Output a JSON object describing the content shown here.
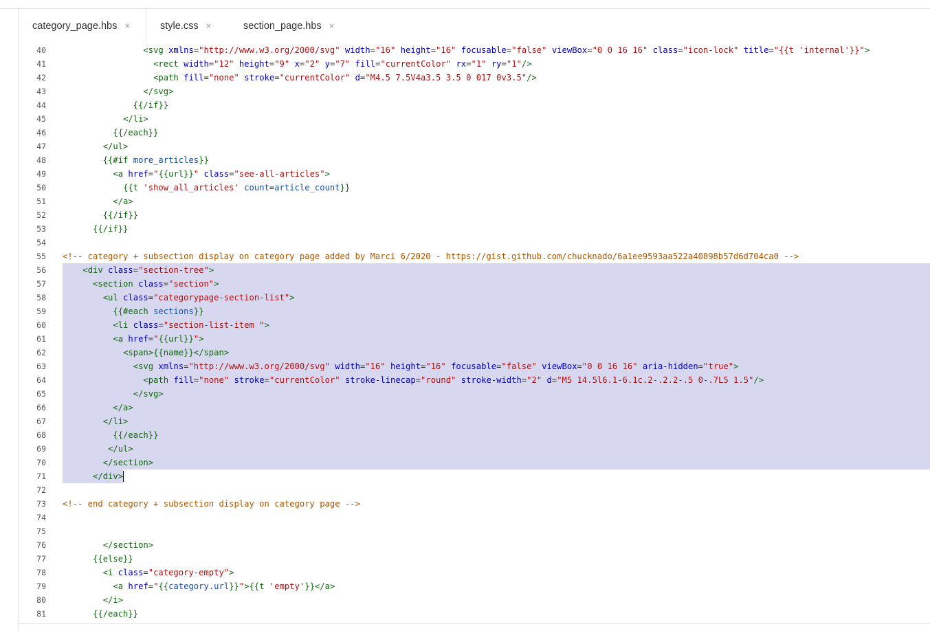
{
  "tabs": [
    {
      "label": "category_page.hbs",
      "active": true
    },
    {
      "label": "style.css",
      "active": false
    },
    {
      "label": "section_page.hbs",
      "active": false
    }
  ],
  "tab_close_glyph": "×",
  "colors": {
    "selection": "#d8d7f0",
    "tag": "#116611",
    "attribute": "#0000bb",
    "string": "#aa1111",
    "comment": "#aa5500",
    "variable": "#1a4c9e"
  },
  "lines": [
    {
      "n": "40",
      "indent": "                ",
      "tokens": [
        [
          "t",
          "<svg "
        ],
        [
          "a",
          "xmlns"
        ],
        [
          "p",
          "="
        ],
        [
          "s",
          "\"http://www.w3.org/2000/svg\""
        ],
        [
          "p",
          " "
        ],
        [
          "a",
          "width"
        ],
        [
          "p",
          "="
        ],
        [
          "s",
          "\"16\""
        ],
        [
          "p",
          " "
        ],
        [
          "a",
          "height"
        ],
        [
          "p",
          "="
        ],
        [
          "s",
          "\"16\""
        ],
        [
          "p",
          " "
        ],
        [
          "a",
          "focusable"
        ],
        [
          "p",
          "="
        ],
        [
          "s",
          "\"false\""
        ],
        [
          "p",
          " "
        ],
        [
          "a",
          "viewBox"
        ],
        [
          "p",
          "="
        ],
        [
          "s",
          "\"0 0 16 16\""
        ],
        [
          "p",
          " "
        ],
        [
          "a",
          "class"
        ],
        [
          "p",
          "="
        ],
        [
          "s",
          "\"icon-lock\""
        ],
        [
          "p",
          " "
        ],
        [
          "a",
          "title"
        ],
        [
          "p",
          "="
        ],
        [
          "s",
          "\"{{t 'internal'}}\""
        ],
        [
          "t",
          ">"
        ]
      ]
    },
    {
      "n": "41",
      "indent": "                  ",
      "tokens": [
        [
          "t",
          "<rect "
        ],
        [
          "a",
          "width"
        ],
        [
          "p",
          "="
        ],
        [
          "s",
          "\"12\""
        ],
        [
          "p",
          " "
        ],
        [
          "a",
          "height"
        ],
        [
          "p",
          "="
        ],
        [
          "s",
          "\"9\""
        ],
        [
          "p",
          " "
        ],
        [
          "a",
          "x"
        ],
        [
          "p",
          "="
        ],
        [
          "s",
          "\"2\""
        ],
        [
          "p",
          " "
        ],
        [
          "a",
          "y"
        ],
        [
          "p",
          "="
        ],
        [
          "s",
          "\"7\""
        ],
        [
          "p",
          " "
        ],
        [
          "a",
          "fill"
        ],
        [
          "p",
          "="
        ],
        [
          "s",
          "\"currentColor\""
        ],
        [
          "p",
          " "
        ],
        [
          "a",
          "rx"
        ],
        [
          "p",
          "="
        ],
        [
          "s",
          "\"1\""
        ],
        [
          "p",
          " "
        ],
        [
          "a",
          "ry"
        ],
        [
          "p",
          "="
        ],
        [
          "s",
          "\"1\""
        ],
        [
          "t",
          "/>"
        ]
      ]
    },
    {
      "n": "42",
      "indent": "                  ",
      "tokens": [
        [
          "t",
          "<path "
        ],
        [
          "a",
          "fill"
        ],
        [
          "p",
          "="
        ],
        [
          "s",
          "\"none\""
        ],
        [
          "p",
          " "
        ],
        [
          "a",
          "stroke"
        ],
        [
          "p",
          "="
        ],
        [
          "s",
          "\"currentColor\""
        ],
        [
          "p",
          " "
        ],
        [
          "a",
          "d"
        ],
        [
          "p",
          "="
        ],
        [
          "s",
          "\"M4.5 7.5V4a3.5 3.5 0 017 0v3.5\""
        ],
        [
          "t",
          "/>"
        ]
      ]
    },
    {
      "n": "43",
      "indent": "                ",
      "tokens": [
        [
          "t",
          "</svg>"
        ]
      ]
    },
    {
      "n": "44",
      "indent": "              ",
      "tokens": [
        [
          "h",
          "{{/if}}"
        ]
      ]
    },
    {
      "n": "45",
      "indent": "            ",
      "tokens": [
        [
          "t",
          "</li>"
        ]
      ]
    },
    {
      "n": "46",
      "indent": "          ",
      "tokens": [
        [
          "h",
          "{{/each}}"
        ]
      ]
    },
    {
      "n": "47",
      "indent": "        ",
      "tokens": [
        [
          "t",
          "</ul>"
        ]
      ]
    },
    {
      "n": "48",
      "indent": "        ",
      "tokens": [
        [
          "h",
          "{{#if "
        ],
        [
          "v",
          "more_articles"
        ],
        [
          "h",
          "}}"
        ]
      ]
    },
    {
      "n": "49",
      "indent": "          ",
      "tokens": [
        [
          "t",
          "<a "
        ],
        [
          "a",
          "href"
        ],
        [
          "p",
          "="
        ],
        [
          "s",
          "\""
        ],
        [
          "h",
          "{{url}}"
        ],
        [
          "s",
          "\""
        ],
        [
          "p",
          " "
        ],
        [
          "a",
          "class"
        ],
        [
          "p",
          "="
        ],
        [
          "s",
          "\"see-all-articles\""
        ],
        [
          "t",
          ">"
        ]
      ]
    },
    {
      "n": "50",
      "indent": "            ",
      "tokens": [
        [
          "h",
          "{{t "
        ],
        [
          "s",
          "'show_all_articles'"
        ],
        [
          "p",
          " "
        ],
        [
          "v",
          "count"
        ],
        [
          "p",
          "="
        ],
        [
          "v",
          "article_count"
        ],
        [
          "h",
          "}}"
        ]
      ]
    },
    {
      "n": "51",
      "indent": "          ",
      "tokens": [
        [
          "t",
          "</a>"
        ]
      ]
    },
    {
      "n": "52",
      "indent": "        ",
      "tokens": [
        [
          "h",
          "{{/if}}"
        ]
      ]
    },
    {
      "n": "53",
      "indent": "      ",
      "tokens": [
        [
          "h",
          "{{/if}}"
        ]
      ]
    },
    {
      "n": "54",
      "indent": "",
      "tokens": []
    },
    {
      "n": "55",
      "indent": "",
      "tokens": [
        [
          "c",
          "<!-- category + subsection display on category page added by Marci 6/2020 - https://gist.github.com/chucknado/6a1ee9593aa522a40898b57d6d704ca0 -->"
        ]
      ]
    },
    {
      "n": "56",
      "indent": "    ",
      "sel": true,
      "tokens": [
        [
          "t",
          "<div "
        ],
        [
          "a",
          "class"
        ],
        [
          "p",
          "="
        ],
        [
          "s",
          "\"section-tree\""
        ],
        [
          "t",
          ">"
        ]
      ]
    },
    {
      "n": "57",
      "indent": "      ",
      "sel": true,
      "tokens": [
        [
          "t",
          "<section "
        ],
        [
          "a",
          "class"
        ],
        [
          "p",
          "="
        ],
        [
          "s",
          "\"section\""
        ],
        [
          "t",
          ">"
        ]
      ]
    },
    {
      "n": "58",
      "indent": "        ",
      "sel": true,
      "tokens": [
        [
          "t",
          "<ul "
        ],
        [
          "a",
          "class"
        ],
        [
          "p",
          "="
        ],
        [
          "s",
          "\"categorypage-section-list\""
        ],
        [
          "t",
          ">"
        ]
      ]
    },
    {
      "n": "59",
      "indent": "          ",
      "sel": true,
      "tokens": [
        [
          "h",
          "{{#each "
        ],
        [
          "v",
          "sections"
        ],
        [
          "h",
          "}}"
        ]
      ]
    },
    {
      "n": "60",
      "indent": "          ",
      "sel": true,
      "tokens": [
        [
          "t",
          "<li "
        ],
        [
          "a",
          "class"
        ],
        [
          "p",
          "="
        ],
        [
          "s",
          "\"section-list-item \""
        ],
        [
          "t",
          ">"
        ]
      ]
    },
    {
      "n": "61",
      "indent": "          ",
      "sel": true,
      "tokens": [
        [
          "t",
          "<a "
        ],
        [
          "a",
          "href"
        ],
        [
          "p",
          "="
        ],
        [
          "s",
          "\""
        ],
        [
          "h",
          "{{url}}"
        ],
        [
          "s",
          "\""
        ],
        [
          "t",
          ">"
        ]
      ]
    },
    {
      "n": "62",
      "indent": "            ",
      "sel": true,
      "tokens": [
        [
          "t",
          "<span>"
        ],
        [
          "h",
          "{{name}}"
        ],
        [
          "t",
          "</span>"
        ]
      ]
    },
    {
      "n": "63",
      "indent": "              ",
      "sel": true,
      "tokens": [
        [
          "t",
          "<svg "
        ],
        [
          "a",
          "xmlns"
        ],
        [
          "p",
          "="
        ],
        [
          "s",
          "\"http://www.w3.org/2000/svg\""
        ],
        [
          "p",
          " "
        ],
        [
          "a",
          "width"
        ],
        [
          "p",
          "="
        ],
        [
          "s",
          "\"16\""
        ],
        [
          "p",
          " "
        ],
        [
          "a",
          "height"
        ],
        [
          "p",
          "="
        ],
        [
          "s",
          "\"16\""
        ],
        [
          "p",
          " "
        ],
        [
          "a",
          "focusable"
        ],
        [
          "p",
          "="
        ],
        [
          "s",
          "\"false\""
        ],
        [
          "p",
          " "
        ],
        [
          "a",
          "viewBox"
        ],
        [
          "p",
          "="
        ],
        [
          "s",
          "\"0 0 16 16\""
        ],
        [
          "p",
          " "
        ],
        [
          "a",
          "aria-hidden"
        ],
        [
          "p",
          "="
        ],
        [
          "s",
          "\"true\""
        ],
        [
          "t",
          ">"
        ]
      ]
    },
    {
      "n": "64",
      "indent": "                ",
      "sel": true,
      "tokens": [
        [
          "t",
          "<path "
        ],
        [
          "a",
          "fill"
        ],
        [
          "p",
          "="
        ],
        [
          "s",
          "\"none\""
        ],
        [
          "p",
          " "
        ],
        [
          "a",
          "stroke"
        ],
        [
          "p",
          "="
        ],
        [
          "s",
          "\"currentColor\""
        ],
        [
          "p",
          " "
        ],
        [
          "a",
          "stroke-linecap"
        ],
        [
          "p",
          "="
        ],
        [
          "s",
          "\"round\""
        ],
        [
          "p",
          " "
        ],
        [
          "a",
          "stroke-width"
        ],
        [
          "p",
          "="
        ],
        [
          "s",
          "\"2\""
        ],
        [
          "p",
          " "
        ],
        [
          "a",
          "d"
        ],
        [
          "p",
          "="
        ],
        [
          "s",
          "\"M5 14.5l6.1-6.1c.2-.2.2-.5 0-.7L5 1.5\""
        ],
        [
          "t",
          "/>"
        ]
      ]
    },
    {
      "n": "65",
      "indent": "              ",
      "sel": true,
      "tokens": [
        [
          "t",
          "</svg>"
        ]
      ]
    },
    {
      "n": "66",
      "indent": "          ",
      "sel": true,
      "tokens": [
        [
          "t",
          "</a>"
        ]
      ]
    },
    {
      "n": "67",
      "indent": "        ",
      "sel": true,
      "tokens": [
        [
          "t",
          "</li>"
        ]
      ]
    },
    {
      "n": "68",
      "indent": "          ",
      "sel": true,
      "tokens": [
        [
          "h",
          "{{/each}}"
        ]
      ]
    },
    {
      "n": "69",
      "indent": "         ",
      "sel": true,
      "tokens": [
        [
          "t",
          "</ul>"
        ]
      ]
    },
    {
      "n": "70",
      "indent": "        ",
      "sel": true,
      "tokens": [
        [
          "t",
          "</section>"
        ]
      ]
    },
    {
      "n": "71",
      "indent": "      ",
      "sel": "partial",
      "cursor": true,
      "tokens": [
        [
          "t",
          "</div>"
        ]
      ]
    },
    {
      "n": "72",
      "indent": "",
      "tokens": []
    },
    {
      "n": "73",
      "indent": "",
      "tokens": [
        [
          "c",
          "<!-- end category + subsection display on category page -->"
        ]
      ]
    },
    {
      "n": "74",
      "indent": "",
      "tokens": []
    },
    {
      "n": "75",
      "indent": "",
      "tokens": []
    },
    {
      "n": "76",
      "indent": "        ",
      "tokens": [
        [
          "t",
          "</section>"
        ]
      ]
    },
    {
      "n": "77",
      "indent": "      ",
      "tokens": [
        [
          "h",
          "{{else}}"
        ]
      ]
    },
    {
      "n": "78",
      "indent": "        ",
      "tokens": [
        [
          "t",
          "<i "
        ],
        [
          "a",
          "class"
        ],
        [
          "p",
          "="
        ],
        [
          "s",
          "\"category-empty\""
        ],
        [
          "t",
          ">"
        ]
      ]
    },
    {
      "n": "79",
      "indent": "          ",
      "tokens": [
        [
          "t",
          "<a "
        ],
        [
          "a",
          "href"
        ],
        [
          "p",
          "="
        ],
        [
          "s",
          "\""
        ],
        [
          "h",
          "{{"
        ],
        [
          "v",
          "category.url"
        ],
        [
          "h",
          "}}"
        ],
        [
          "s",
          "\""
        ],
        [
          "t",
          ">"
        ],
        [
          "h",
          "{{t "
        ],
        [
          "s",
          "'empty'"
        ],
        [
          "h",
          "}}"
        ],
        [
          "t",
          "</a>"
        ]
      ]
    },
    {
      "n": "80",
      "indent": "        ",
      "tokens": [
        [
          "t",
          "</i>"
        ]
      ]
    },
    {
      "n": "81",
      "indent": "      ",
      "tokens": [
        [
          "h",
          "{{/each}}"
        ]
      ]
    }
  ]
}
